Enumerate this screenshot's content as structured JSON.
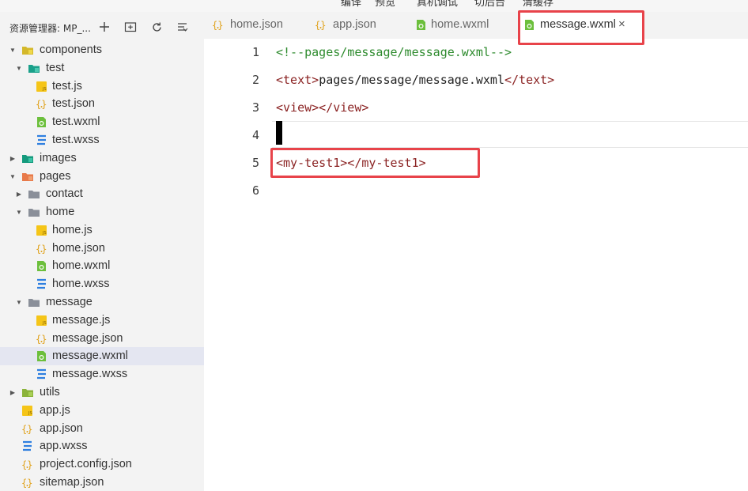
{
  "menubar": {
    "items": [
      "编译",
      "预览",
      "真机调试",
      "切后台",
      "清缓存"
    ]
  },
  "sidebar": {
    "title": "资源管理器: MP_...",
    "tools": [
      "add-file-icon",
      "add-folder-icon",
      "refresh-icon",
      "collapse-icon"
    ],
    "tree": [
      {
        "label": "components",
        "kind": "folder-components",
        "expanded": true
      },
      {
        "label": "test",
        "kind": "folder-test",
        "expanded": true
      },
      {
        "label": "test.js",
        "kind": "js"
      },
      {
        "label": "test.json",
        "kind": "json"
      },
      {
        "label": "test.wxml",
        "kind": "wxml"
      },
      {
        "label": "test.wxss",
        "kind": "wxss"
      },
      {
        "label": "images",
        "kind": "folder-images",
        "expanded": false
      },
      {
        "label": "pages",
        "kind": "folder-pages",
        "expanded": true
      },
      {
        "label": "contact",
        "kind": "folder",
        "expanded": false
      },
      {
        "label": "home",
        "kind": "folder",
        "expanded": true
      },
      {
        "label": "home.js",
        "kind": "js"
      },
      {
        "label": "home.json",
        "kind": "json"
      },
      {
        "label": "home.wxml",
        "kind": "wxml"
      },
      {
        "label": "home.wxss",
        "kind": "wxss"
      },
      {
        "label": "message",
        "kind": "folder",
        "expanded": true
      },
      {
        "label": "message.js",
        "kind": "js"
      },
      {
        "label": "message.json",
        "kind": "json"
      },
      {
        "label": "message.wxml",
        "kind": "wxml",
        "selected": true
      },
      {
        "label": "message.wxss",
        "kind": "wxss"
      },
      {
        "label": "utils",
        "kind": "folder-utils",
        "expanded": false
      },
      {
        "label": "app.js",
        "kind": "js"
      },
      {
        "label": "app.json",
        "kind": "json"
      },
      {
        "label": "app.wxss",
        "kind": "wxss"
      },
      {
        "label": "project.config.json",
        "kind": "json"
      },
      {
        "label": "sitemap.json",
        "kind": "json"
      }
    ]
  },
  "tabs": [
    {
      "label": "home.json",
      "kind": "json"
    },
    {
      "label": "app.json",
      "kind": "json"
    },
    {
      "label": "home.wxml",
      "kind": "wxml"
    },
    {
      "label": "message.wxml",
      "kind": "wxml",
      "active": true,
      "close": "×"
    }
  ],
  "editor": {
    "lines": [
      {
        "num": "1",
        "tokens": [
          {
            "t": "<!--pages/message/message.wxml-->",
            "c": "comment"
          }
        ]
      },
      {
        "num": "2",
        "tokens": [
          {
            "t": "<text>",
            "c": "tag"
          },
          {
            "t": "pages/message/message.wxml",
            "c": "text"
          },
          {
            "t": "</text>",
            "c": "tag"
          }
        ]
      },
      {
        "num": "3",
        "tokens": [
          {
            "t": "<view></view>",
            "c": "tag"
          }
        ]
      },
      {
        "num": "4",
        "tokens": []
      },
      {
        "num": "5",
        "tokens": [
          {
            "t": "<my-test1></my-test1>",
            "c": "tag"
          }
        ]
      },
      {
        "num": "6",
        "tokens": []
      }
    ]
  },
  "colors": {
    "highlight": "#e8434a",
    "js": "#f5c518",
    "json": "#e0a21c",
    "wxml": "#6cbf3c",
    "wxss": "#2f7fe0",
    "folder": "#8a8f99",
    "comment": "#2e8b2e",
    "tag": "#8b2323"
  }
}
